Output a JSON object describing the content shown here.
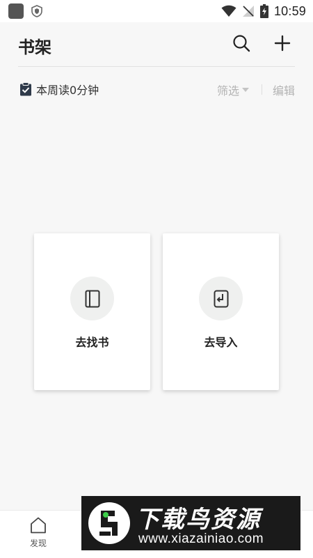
{
  "status_bar": {
    "time": "10:59"
  },
  "header": {
    "title": "书架"
  },
  "sub_bar": {
    "reading_stat": "本周读0分钟",
    "filter_label": "筛选",
    "edit_label": "编辑"
  },
  "cards": [
    {
      "label": "去找书",
      "icon": "book-icon"
    },
    {
      "label": "去导入",
      "icon": "import-icon"
    }
  ],
  "bottom_nav": {
    "items": [
      {
        "label": "发现",
        "icon": "home-icon"
      }
    ]
  },
  "watermark": {
    "title": "下载鸟资源",
    "url": "www.xiazainiao.com"
  },
  "colors": {
    "background": "#f7f7f7",
    "card": "#ffffff",
    "muted_text": "#b3b3b3",
    "icon_circle": "#eff0ef"
  }
}
